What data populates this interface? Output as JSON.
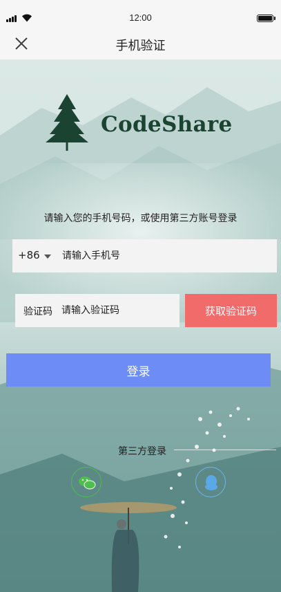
{
  "status_bar": {
    "time": "12:00"
  },
  "nav": {
    "title": "手机验证"
  },
  "brand": {
    "name": "CodeShare"
  },
  "instruction": "请输入您的手机号码，或使用第三方账号登录",
  "phone": {
    "country_code": "+86",
    "placeholder": "请输入手机号"
  },
  "verification": {
    "label": "验证码",
    "placeholder": "请输入验证码",
    "get_code_label": "获取验证码"
  },
  "login": {
    "label": "登录"
  },
  "third_party": {
    "label": "第三方登录",
    "icons": [
      "wechat-icon",
      "qq-icon"
    ]
  },
  "colors": {
    "get_code": "#f26b6b",
    "login": "#6d8cf6",
    "brand": "#1b4332",
    "wechat": "#4cbf4c",
    "qq": "#5aa9e6"
  }
}
